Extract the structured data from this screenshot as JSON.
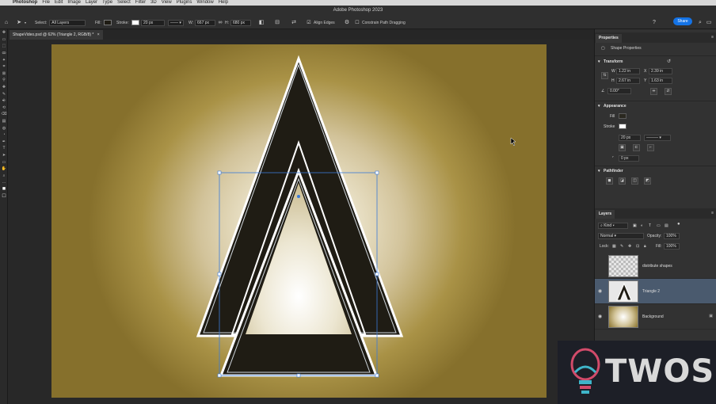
{
  "menubar": {
    "items": [
      "Photoshop",
      "File",
      "Edit",
      "Image",
      "Layer",
      "Type",
      "Select",
      "Filter",
      "3D",
      "View",
      "Plugins",
      "Window",
      "Help"
    ]
  },
  "app": {
    "title": "Adobe Photoshop 2023"
  },
  "options": {
    "select_label": "Select:",
    "select_value": "All Layers",
    "fill_label": "Fill:",
    "stroke_label": "Stroke:",
    "stroke_width": "20 px",
    "w_label": "W:",
    "w_value": "667 px",
    "h_label": "H:",
    "h_value": "680 px",
    "align_edges": "Align Edges",
    "constrain": "Constrain Path Dragging",
    "share": "Share",
    "fill_color": "#1f1c14",
    "stroke_color": "#ffffff"
  },
  "document": {
    "tab_title": "ShapeVideo.psd @ 62% (Triangle 2, RGB/8) *"
  },
  "properties": {
    "tab": "Properties",
    "type_label": "Shape Properties",
    "transform_title": "Transform",
    "w_label": "W",
    "w": "1.22 in",
    "x_label": "X",
    "x": "2.39 in",
    "h_label": "H",
    "h": "2.67 in",
    "y_label": "Y",
    "y": "1.63 in",
    "angle": "0.00°",
    "appearance_title": "Appearance",
    "fill_label": "Fill",
    "stroke_label": "Stroke",
    "stroke_width": "20 px",
    "corner_radius": "0 px",
    "pathfinder_title": "Pathfinder"
  },
  "layers": {
    "tab": "Layers",
    "filter": "Kind",
    "blend": "Normal",
    "opacity_label": "Opacity:",
    "opacity": "100%",
    "lock_label": "Lock:",
    "fill_label": "Fill:",
    "fill": "100%",
    "items": [
      {
        "name": "distribute shapes",
        "visible": false,
        "selected": false
      },
      {
        "name": "Triangle 2",
        "visible": true,
        "selected": true
      },
      {
        "name": "Background",
        "visible": true,
        "selected": false,
        "locked": true
      }
    ]
  },
  "watermark": {
    "text": "TWOS"
  },
  "tools": {
    "icons": [
      "move-icon",
      "artboard-icon",
      "marquee-icon",
      "lasso-icon",
      "magic-wand-icon",
      "crop-icon",
      "frame-icon",
      "eyedropper-icon",
      "healing-icon",
      "brush-icon",
      "stamp-icon",
      "history-brush-icon",
      "eraser-icon",
      "gradient-icon",
      "blur-icon",
      "dodge-icon",
      "pen-icon",
      "type-icon",
      "path-select-icon",
      "shape-icon",
      "hand-icon",
      "zoom-icon",
      "more-icon",
      "foreground-swatch-icon",
      "background-swatch-icon"
    ]
  }
}
